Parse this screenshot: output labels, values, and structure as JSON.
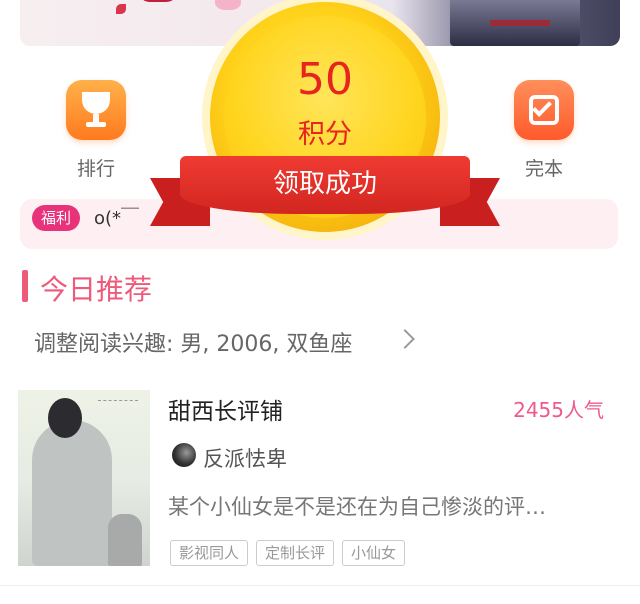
{
  "nav": {
    "rank": {
      "label": "排行",
      "icon": "trophy-icon"
    },
    "finished": {
      "label": "完本",
      "icon": "checklist-icon"
    }
  },
  "welfare": {
    "tag": "福利",
    "text": "o(*￣"
  },
  "popup": {
    "value": "50",
    "unit": "积分",
    "message": "领取成功"
  },
  "section": {
    "title": "今日推荐",
    "interest": "调整阅读兴趣: 男, 2006, 双鱼座"
  },
  "book": {
    "title": "甜西长评铺",
    "popularity": "2455人气",
    "author": "反派怯卑",
    "description": "某个小仙女是不是还在为自己惨淡的评…",
    "tags": [
      "影视同人",
      "定制长评",
      "小仙女"
    ]
  },
  "colors": {
    "accent": "#ee5a7a",
    "popup_red": "#e8241e",
    "coin_gold": "#ffd21a"
  }
}
